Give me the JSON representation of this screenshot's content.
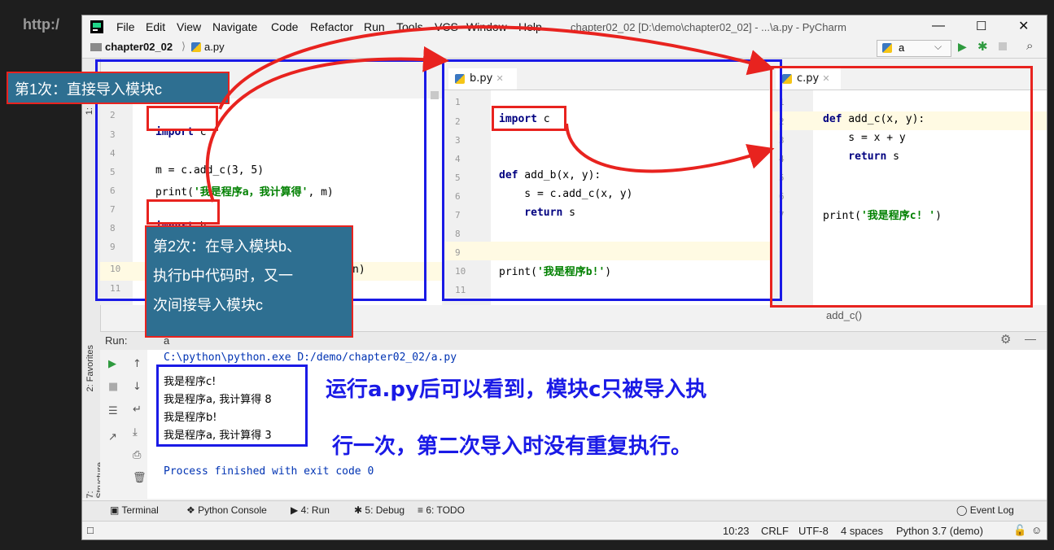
{
  "bg_watermark": {
    "line1": "http:/",
    "line2": "…"
  },
  "app": {
    "title": "chapter02_02 [D:\\demo\\chapter02_02] - ...\\a.py - PyCharm"
  },
  "menu": [
    "File",
    "Edit",
    "View",
    "Navigate",
    "Code",
    "Refactor",
    "Run",
    "Tools",
    "VCS",
    "Window",
    "Help"
  ],
  "breadcrumb": {
    "project": "chapter02_02",
    "file": "a.py"
  },
  "run_config": {
    "name": "a"
  },
  "tabs": {
    "b": "b.py",
    "c": "c.py"
  },
  "editor_a": {
    "lines": [
      "1",
      "2",
      "3",
      "4",
      "5",
      "6",
      "7",
      "8",
      "9",
      "10",
      "11"
    ],
    "code": {
      "l2_kw": "import",
      "l2_rest": " c",
      "l4": "m = c.add_c(3, 5)",
      "l5_a": "print(",
      "l5_s": "'我是程序a，我计算得'",
      "l5_b": ", m)",
      "l7_kw": "import",
      "l7_rest": " b",
      "l10_tail": "n)"
    }
  },
  "editor_b": {
    "lines": [
      "1",
      "2",
      "3",
      "4",
      "5",
      "6",
      "7",
      "8",
      "9",
      "10",
      "11"
    ],
    "code": {
      "l2_kw": "import",
      "l2_rest": " c",
      "l5_kw": "def",
      "l5_rest": " add_b(x, y):",
      "l6": "    s = c.add_c(x, y)",
      "l7_kw": "    return",
      "l7_rest": " s",
      "l10_a": "print(",
      "l10_s": "'我是程序b!'",
      "l10_b": ")"
    }
  },
  "editor_c": {
    "lines": [
      "1",
      "2",
      "3",
      "4",
      "5",
      "6",
      "7"
    ],
    "code": {
      "l2_kw": "def",
      "l2_rest": " add_c(x, y):",
      "l3": "    s = x + y",
      "l4_kw": "    return",
      "l4_rest": " s",
      "l7_a": "print(",
      "l7_s": "'我是程序c! '",
      "l7_b": ")"
    },
    "breadcrumb": "add_c()"
  },
  "callouts": {
    "first": "第1次：直接导入模块c",
    "second": [
      "第2次：在导入模块b、",
      "执行b中代码时，又一",
      "次间接导入模块c"
    ]
  },
  "run": {
    "label": "Run:",
    "tab": "a",
    "command": "C:\\python\\python.exe D:/demo/chapter02_02/a.py",
    "output": [
      "我是程序c!",
      "我是程序a, 我计算得 8",
      "我是程序b!",
      "我是程序a, 我计算得 3"
    ],
    "finished": "Process finished with exit code 0"
  },
  "annotation": {
    "line1": "运行a.py后可以看到，模块c只被导入执",
    "line2": "行一次，第二次导入时没有重复执行。"
  },
  "side_tabs": {
    "favorites": "2: Favorites",
    "structure": "7: Structure",
    "project": "1:"
  },
  "bottom_tabs": [
    "Terminal",
    "Python Console",
    "4: Run",
    "5: Debug",
    "6: TODO"
  ],
  "event_log": "Event Log",
  "status": {
    "position": "10:23",
    "line_sep": "CRLF",
    "encoding": "UTF-8",
    "indent": "4 spaces",
    "interpreter": "Python 3.7 (demo)"
  },
  "colors": {
    "blue_box": "#1a1ae6",
    "red_box": "#e8231f",
    "callout_bg": "#2e6f91"
  }
}
